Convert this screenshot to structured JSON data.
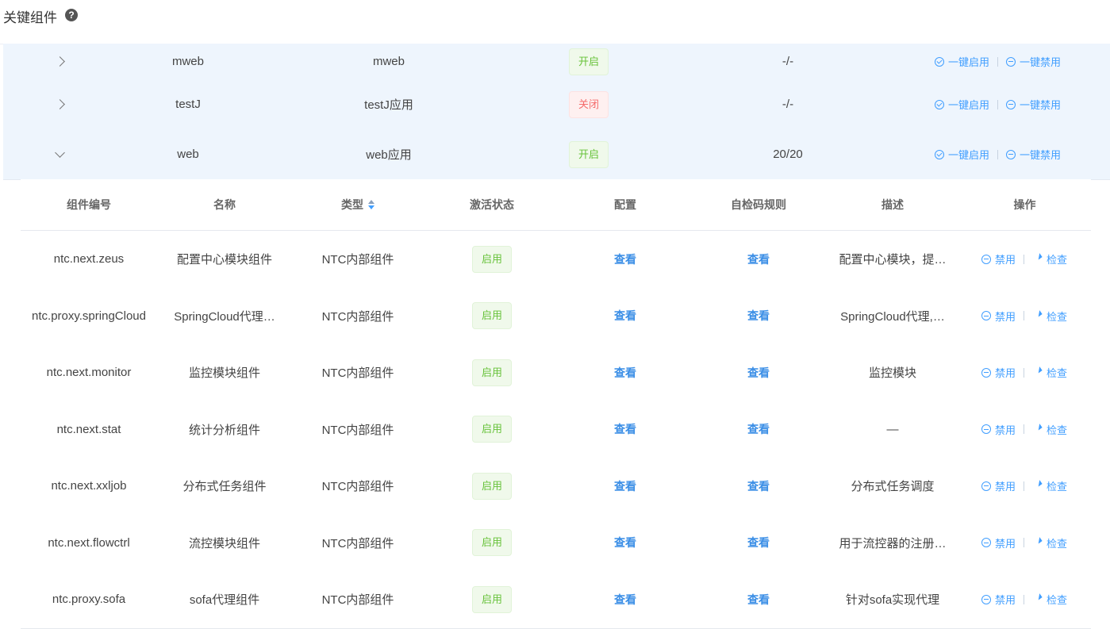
{
  "header": {
    "title": "关键组件",
    "help_icon": "question-circle-icon"
  },
  "apps": [
    {
      "code": "mweb",
      "name": "mweb",
      "status": "开启",
      "status_color": "green",
      "count": "-/-",
      "expanded": false,
      "enable_all": "一键启用",
      "disable_all": "一键禁用"
    },
    {
      "code": "testJ",
      "name": "testJ应用",
      "status": "关闭",
      "status_color": "red",
      "count": "-/-",
      "expanded": false,
      "enable_all": "一键启用",
      "disable_all": "一键禁用"
    },
    {
      "code": "web",
      "name": "web应用",
      "status": "开启",
      "status_color": "green",
      "count": "20/20",
      "expanded": true,
      "enable_all": "一键启用",
      "disable_all": "一键禁用"
    }
  ],
  "components": {
    "columns": [
      "组件编号",
      "名称",
      "类型",
      "激活状态",
      "配置",
      "自检码规则",
      "描述",
      "操作"
    ],
    "rows": [
      {
        "id": "ntc.next.zeus",
        "name": "配置中心模块组件",
        "type": "NTC内部组件",
        "state": "启用",
        "config": "查看",
        "rule": "查看",
        "desc": "配置中心模块，提…",
        "disable": "禁用",
        "check": "检查"
      },
      {
        "id": "ntc.proxy.springCloud",
        "name": "SpringCloud代理…",
        "type": "NTC内部组件",
        "state": "启用",
        "config": "查看",
        "rule": "查看",
        "desc": "SpringCloud代理,…",
        "disable": "禁用",
        "check": "检查"
      },
      {
        "id": "ntc.next.monitor",
        "name": "监控模块组件",
        "type": "NTC内部组件",
        "state": "启用",
        "config": "查看",
        "rule": "查看",
        "desc": "监控模块",
        "disable": "禁用",
        "check": "检查"
      },
      {
        "id": "ntc.next.stat",
        "name": "统计分析组件",
        "type": "NTC内部组件",
        "state": "启用",
        "config": "查看",
        "rule": "查看",
        "desc": "—",
        "disable": "禁用",
        "check": "检查"
      },
      {
        "id": "ntc.next.xxljob",
        "name": "分布式任务组件",
        "type": "NTC内部组件",
        "state": "启用",
        "config": "查看",
        "rule": "查看",
        "desc": "分布式任务调度",
        "disable": "禁用",
        "check": "检查"
      },
      {
        "id": "ntc.next.flowctrl",
        "name": "流控模块组件",
        "type": "NTC内部组件",
        "state": "启用",
        "config": "查看",
        "rule": "查看",
        "desc": "用于流控器的注册…",
        "disable": "禁用",
        "check": "检查"
      },
      {
        "id": "ntc.proxy.sofa",
        "name": "sofa代理组件",
        "type": "NTC内部组件",
        "state": "启用",
        "config": "查看",
        "rule": "查看",
        "desc": "针对sofa实现代理",
        "disable": "禁用",
        "check": "检查"
      }
    ]
  }
}
